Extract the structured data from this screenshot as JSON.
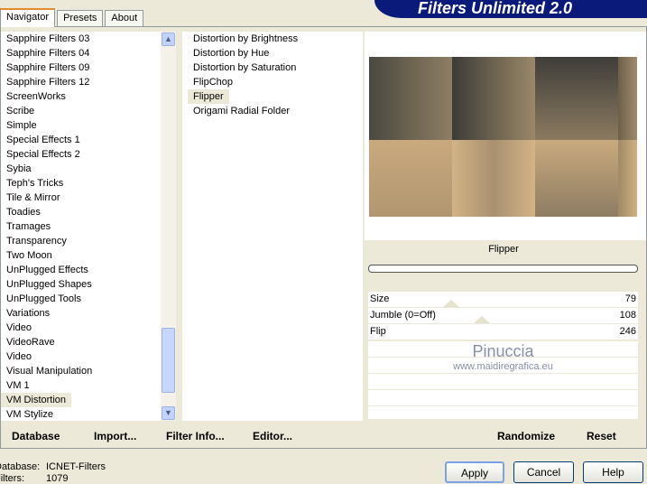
{
  "app": {
    "title": "Filters Unlimited 2.0"
  },
  "tabs": [
    {
      "label": "Navigator",
      "active": true
    },
    {
      "label": "Presets"
    },
    {
      "label": "About"
    }
  ],
  "categories": [
    "Sapphire Filters 03",
    "Sapphire Filters 04",
    "Sapphire Filters 09",
    "Sapphire Filters 12",
    "ScreenWorks",
    "Scribe",
    "Simple",
    "Special Effects 1",
    "Special Effects 2",
    "Sybia",
    "Teph's Tricks",
    "Tile & Mirror",
    "Toadies",
    "Tramages",
    "Transparency",
    "Two Moon",
    "UnPlugged Effects",
    "UnPlugged Shapes",
    "UnPlugged Tools",
    "Variations",
    "Video",
    "VideoRave",
    "Video",
    "Visual Manipulation",
    "VM 1",
    "VM Distortion",
    "VM Stylize"
  ],
  "selected_category": "VM Distortion",
  "filters": [
    "Distortion by Brightness",
    "Distortion by Hue",
    "Distortion by Saturation",
    "FlipChop",
    "Flipper",
    "Origami Radial Folder"
  ],
  "selected_filter": "Flipper",
  "filter_name": "Flipper",
  "params": [
    {
      "label": "Size",
      "value": "79"
    },
    {
      "label": "Jumble (0=Off)",
      "value": "108"
    },
    {
      "label": "Flip",
      "value": "246"
    }
  ],
  "watermark": {
    "name": "Pinuccia",
    "url": "www.maidiregrafica.eu"
  },
  "toolbar": {
    "database": "Database",
    "import": "Import...",
    "filter_info": "Filter Info...",
    "editor": "Editor...",
    "randomize": "Randomize",
    "reset": "Reset"
  },
  "status": {
    "database_label": "Database:",
    "database_value": "ICNET-Filters",
    "filters_label": "Filters:",
    "filters_value": "1079"
  },
  "buttons": {
    "apply": "Apply",
    "cancel": "Cancel",
    "help": "Help"
  }
}
